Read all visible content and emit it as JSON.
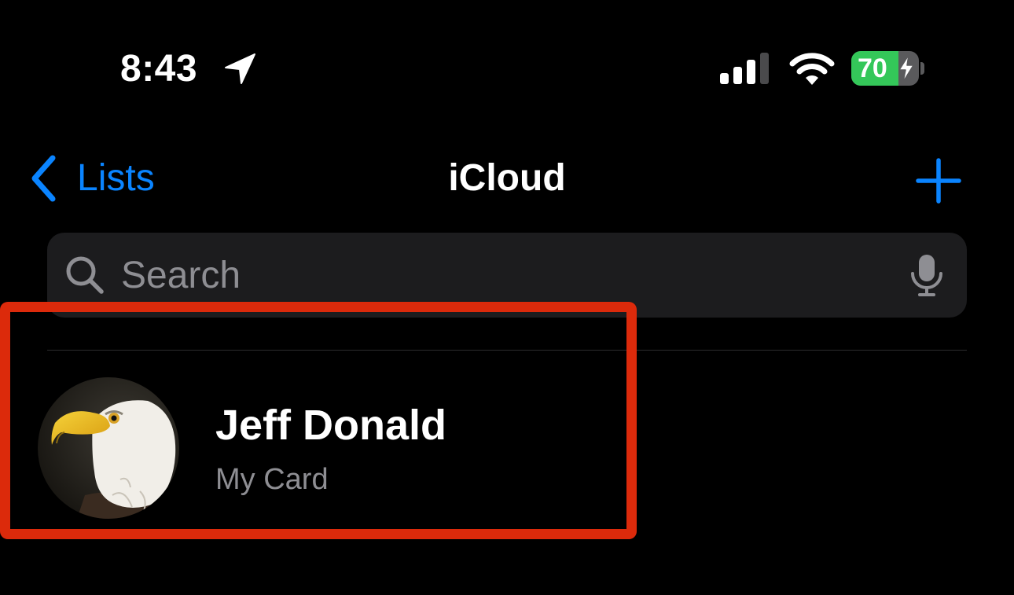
{
  "status_bar": {
    "time": "8:43",
    "battery_percent": "70",
    "battery_level": 0.7,
    "charging": true,
    "icons": [
      "location-arrow-icon",
      "cellular-signal-icon",
      "wifi-icon",
      "battery-icon",
      "charging-bolt-icon"
    ]
  },
  "nav": {
    "back_label": "Lists",
    "title": "iCloud",
    "add_icon": "plus-icon"
  },
  "search": {
    "placeholder": "Search",
    "value": "",
    "icons": [
      "search-icon",
      "microphone-icon"
    ]
  },
  "my_card": {
    "name": "Jeff Donald",
    "subtitle": "My Card",
    "avatar": "bald-eagle-photo"
  },
  "colors": {
    "background": "#000000",
    "accent": "#0a84ff",
    "battery_green": "#34c759",
    "search_field": "#1c1c1e",
    "secondary_text": "#8e8e93",
    "highlight": "#dc2a0b"
  }
}
